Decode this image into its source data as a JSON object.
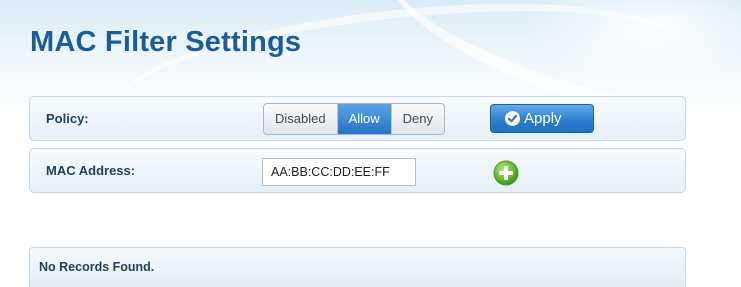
{
  "page": {
    "title": "MAC Filter Settings"
  },
  "policy": {
    "label": "Policy:",
    "options": [
      "Disabled",
      "Allow",
      "Deny"
    ],
    "selected": "Allow",
    "apply_label": "Apply"
  },
  "mac": {
    "label": "MAC Address:",
    "value": "AA:BB:CC:DD:EE:FF",
    "add_icon": "plus-circle-icon"
  },
  "records": {
    "empty_text": "No Records Found."
  },
  "colors": {
    "title": "#1a5e99",
    "accent_blue": "#2673c4",
    "add_green": "#6cbf3a"
  }
}
